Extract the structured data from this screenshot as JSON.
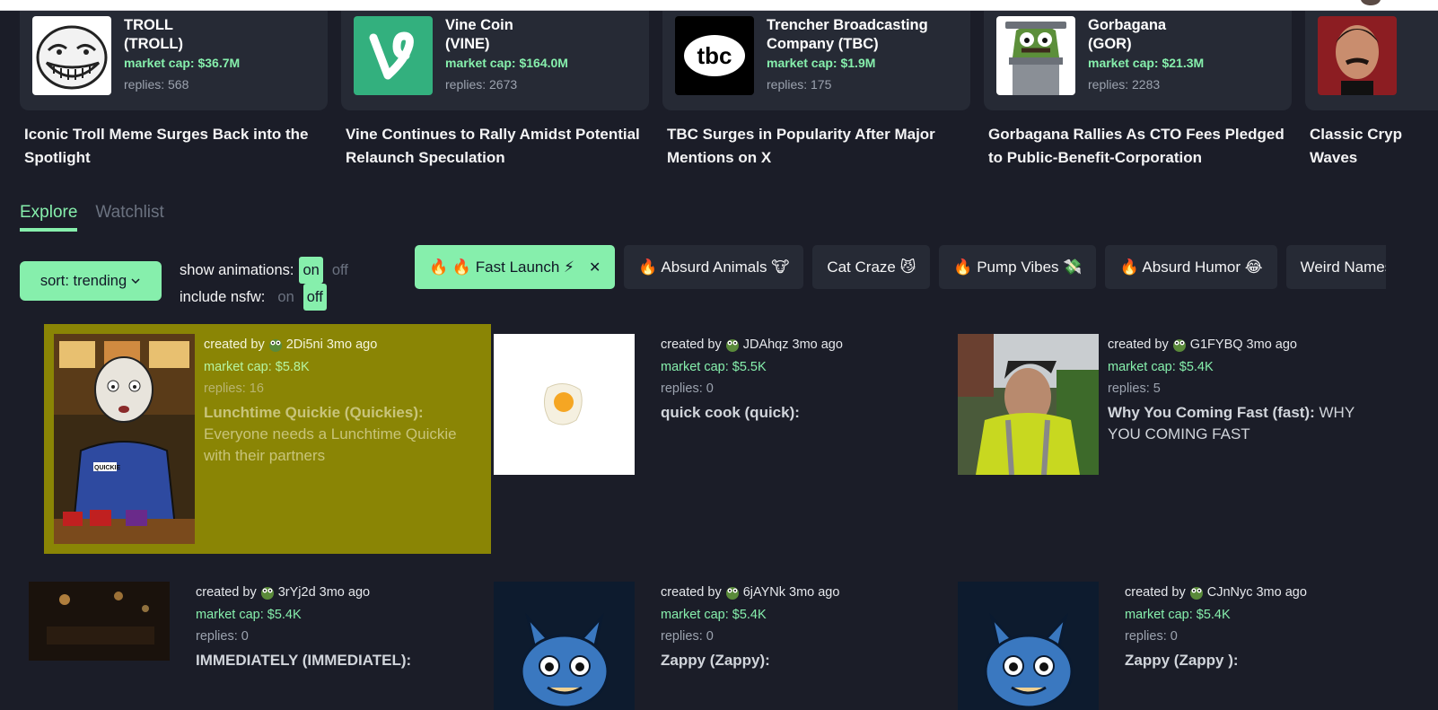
{
  "featured": [
    {
      "name": "TROLL\n(TROLL)",
      "mcap": "market cap: $36.7M",
      "replies": "replies: 568",
      "headline": "Iconic Troll Meme Surges Back into the Spotlight",
      "image": "troll-face-icon"
    },
    {
      "name": "Vine Coin\n(VINE)",
      "mcap": "market cap: $164.0M",
      "replies": "replies: 2673",
      "headline": "Vine Continues to Rally Amidst Potential Relaunch Speculation",
      "image": "vine-logo-icon"
    },
    {
      "name": "Trencher Broadcasting Company (TBC)",
      "mcap": "market cap: $1.9M",
      "replies": "replies: 175",
      "headline": "TBC Surges in Popularity After Major Mentions on X",
      "image": "tbc-logo-icon",
      "logo_text": "tbc"
    },
    {
      "name": "Gorbagana\n(GOR)",
      "mcap": "market cap: $21.3M",
      "replies": "replies: 2283",
      "headline": "Gorbagana Rallies As CTO Fees Pledged to Public-Benefit-Corporation",
      "image": "trash-monster-icon"
    },
    {
      "name": "",
      "mcap": "",
      "replies": "",
      "headline": "Classic Cryp Waves",
      "image": "portrait-photo"
    }
  ],
  "tabs": [
    {
      "label": "Explore",
      "active": true
    },
    {
      "label": "Watchlist",
      "active": false
    }
  ],
  "sort": {
    "label": "sort: trending"
  },
  "toggles": {
    "animations": {
      "label": "show animations:",
      "on": "on",
      "off": "off",
      "selected": "on"
    },
    "nsfw": {
      "label": "include nsfw:",
      "on": "on",
      "off": "off",
      "selected": "off"
    }
  },
  "chips": [
    {
      "label": "🔥 🔥 Fast Launch ⚡",
      "active": true,
      "close": "✕"
    },
    {
      "label": "🔥 Absurd Animals 🐮",
      "active": false
    },
    {
      "label": "Cat Craze 😼",
      "active": false
    },
    {
      "label": "🔥 Pump Vibes 💸",
      "active": false
    },
    {
      "label": "🔥 Absurd Humor 😂",
      "active": false
    },
    {
      "label": "Weird Names",
      "active": false
    }
  ],
  "tokens": [
    {
      "creator": "2Di5ni",
      "age": "3mo ago",
      "created_prefix": "created by",
      "mcap": "market cap: $5.8K",
      "replies": "replies: 16",
      "title": "Lunchtime Quickie (Quickies):",
      "desc": "Everyone needs a Lunchtime Quickie with their partners",
      "thumb": "quickie-cartoon",
      "badge": "QUICKIE",
      "highlighted": true
    },
    {
      "creator": "JDAhqz",
      "age": "3mo ago",
      "created_prefix": "created by",
      "mcap": "market cap: $5.5K",
      "replies": "replies: 0",
      "title": "quick cook (quick):",
      "desc": "",
      "thumb": "fried-egg"
    },
    {
      "creator": "G1FYBQ",
      "age": "3mo ago",
      "created_prefix": "created by",
      "mcap": "market cap: $5.4K",
      "replies": "replies: 5",
      "title": "Why You Coming Fast (fast):",
      "desc": "WHY YOU COMING FAST",
      "thumb": "man-photo"
    },
    {
      "creator": "3rYj2d",
      "age": "3mo ago",
      "created_prefix": "created by",
      "mcap": "market cap: $5.4K",
      "replies": "replies: 0",
      "title": "IMMEDIATELY (IMMEDIATEL):",
      "desc": "",
      "thumb": "dark-room-photo"
    },
    {
      "creator": "6jAYNk",
      "age": "3mo ago",
      "created_prefix": "created by",
      "mcap": "market cap: $5.4K",
      "replies": "replies: 0",
      "title": "Zappy (Zappy):",
      "desc": "",
      "thumb": "blue-cat"
    },
    {
      "creator": "CJnNyc",
      "age": "3mo ago",
      "created_prefix": "created by",
      "mcap": "market cap: $5.4K",
      "replies": "replies: 0",
      "title": "Zappy (Zappy ):",
      "desc": "",
      "thumb": "blue-cat"
    }
  ],
  "colors": {
    "accent": "#86efac",
    "background": "#1b1d28",
    "card": "#262a35",
    "highlight": "#8a8505"
  }
}
